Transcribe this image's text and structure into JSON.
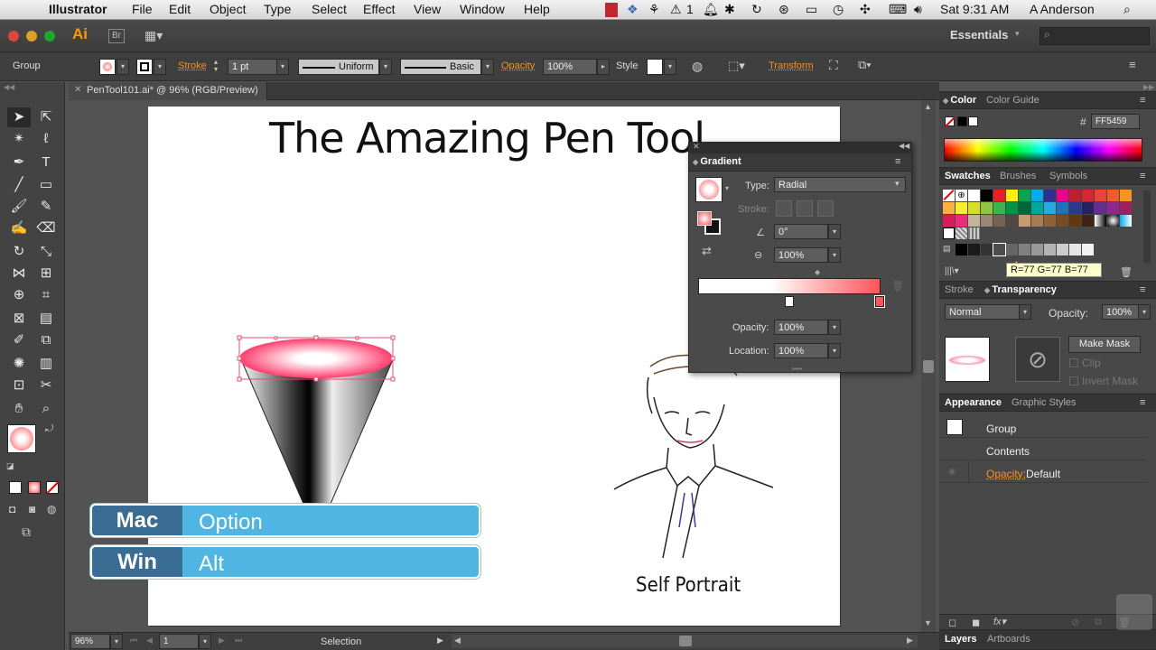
{
  "menubar": {
    "app_name": "Illustrator",
    "menus": [
      "File",
      "Edit",
      "Object",
      "Type",
      "Select",
      "Effect",
      "View",
      "Window",
      "Help"
    ],
    "clock": "Sat 9:31 AM",
    "user": "A Anderson",
    "notification_count": "1"
  },
  "appbar": {
    "logo": "Ai",
    "bridge": "Br",
    "workspace": "Essentials"
  },
  "controlbar": {
    "selection_type": "Group",
    "stroke_label": "Stroke",
    "stroke_weight": "1 pt",
    "profile": "Uniform",
    "brush": "Basic",
    "opacity_label": "Opacity",
    "opacity_value": "100%",
    "style_label": "Style",
    "transform_label": "Transform"
  },
  "document": {
    "tab_title": "PenTool101.ai* @ 96% (RGB/Preview)",
    "artboard_title": "The Amazing Pen Tool",
    "portrait_caption": "Self Portrait"
  },
  "status": {
    "zoom": "96%",
    "artboard_number": "1",
    "current_tool": "Selection"
  },
  "callouts": [
    {
      "platform": "Mac",
      "key": "Option"
    },
    {
      "platform": "Win",
      "key": "Alt"
    }
  ],
  "gradient_panel": {
    "title": "Gradient",
    "type_label": "Type:",
    "type_value": "Radial",
    "stroke_label": "Stroke:",
    "angle_value": "0°",
    "aspect_value": "100%",
    "opacity_label": "Opacity:",
    "opacity_value": "100%",
    "location_label": "Location:",
    "location_value": "100%",
    "start_color": "#ffffff",
    "end_color": "#ff5459"
  },
  "color_panel": {
    "tabs": [
      "Color",
      "Color Guide"
    ],
    "hex_label": "#",
    "hex_value": "FF5459"
  },
  "swatches_panel": {
    "tabs": [
      "Swatches",
      "Brushes",
      "Symbols"
    ],
    "tooltip": "R=77 G=77 B=77"
  },
  "transparency_panel": {
    "tabs": [
      "Stroke",
      "Transparency"
    ],
    "blend_mode": "Normal",
    "opacity_label": "Opacity:",
    "opacity_value": "100%",
    "make_mask": "Make Mask",
    "clip": "Clip",
    "invert_mask": "Invert Mask"
  },
  "appearance_panel": {
    "tabs": [
      "Appearance",
      "Graphic Styles"
    ],
    "rows": [
      {
        "label": "Group"
      },
      {
        "label": "Contents"
      },
      {
        "label": "Opacity:",
        "value": "Default"
      }
    ]
  },
  "layers_panel": {
    "tabs": [
      "Layers",
      "Artboards"
    ]
  }
}
